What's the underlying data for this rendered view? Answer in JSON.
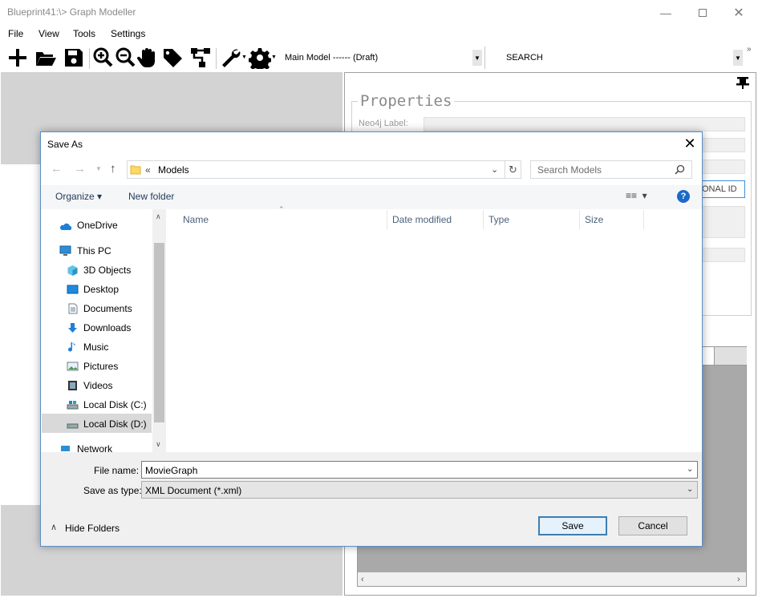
{
  "app": {
    "title": "Blueprint41:\\> Graph Modeller",
    "menu": [
      "File",
      "View",
      "Tools",
      "Settings"
    ],
    "toolbar": {
      "icons": [
        "add-icon",
        "open-folder-icon",
        "save-icon",
        "zoom-in-icon",
        "zoom-out-icon",
        "pan-hand-icon",
        "tag-icon",
        "hierarchy-icon",
        "wrench-icon",
        "gear-icon"
      ],
      "model_combo": "Main Model ------ (Draft)",
      "search_combo": "SEARCH"
    },
    "properties": {
      "title": "Properties",
      "neo4j_label": "Neo4j Label:",
      "optional_id_partial": "ONAL ID"
    }
  },
  "dialog": {
    "title": "Save As",
    "address": {
      "chevron": "«",
      "path": "Models"
    },
    "search_placeholder": "Search Models",
    "commands": {
      "organize": "Organize ▾",
      "new_folder": "New folder"
    },
    "nav_items": [
      {
        "label": "OneDrive",
        "icon": "onedrive-icon"
      },
      {
        "label": "This PC",
        "icon": "computer-icon"
      },
      {
        "label": "3D Objects",
        "icon": "3d-objects-icon"
      },
      {
        "label": "Desktop",
        "icon": "desktop-icon"
      },
      {
        "label": "Documents",
        "icon": "documents-icon"
      },
      {
        "label": "Downloads",
        "icon": "downloads-icon"
      },
      {
        "label": "Music",
        "icon": "music-icon"
      },
      {
        "label": "Pictures",
        "icon": "pictures-icon"
      },
      {
        "label": "Videos",
        "icon": "videos-icon"
      },
      {
        "label": "Local Disk (C:)",
        "icon": "drive-c-icon"
      },
      {
        "label": "Local Disk (D:)",
        "icon": "drive-d-icon"
      },
      {
        "label": "Network",
        "icon": "network-icon"
      }
    ],
    "columns": [
      "Name",
      "Date modified",
      "Type",
      "Size"
    ],
    "file_name_label": "File name:",
    "file_name_value": "MovieGraph",
    "save_type_label": "Save as type:",
    "save_type_value": "XML Document (*.xml)",
    "hide_folders": "Hide Folders",
    "save_button": "Save",
    "cancel_button": "Cancel"
  }
}
